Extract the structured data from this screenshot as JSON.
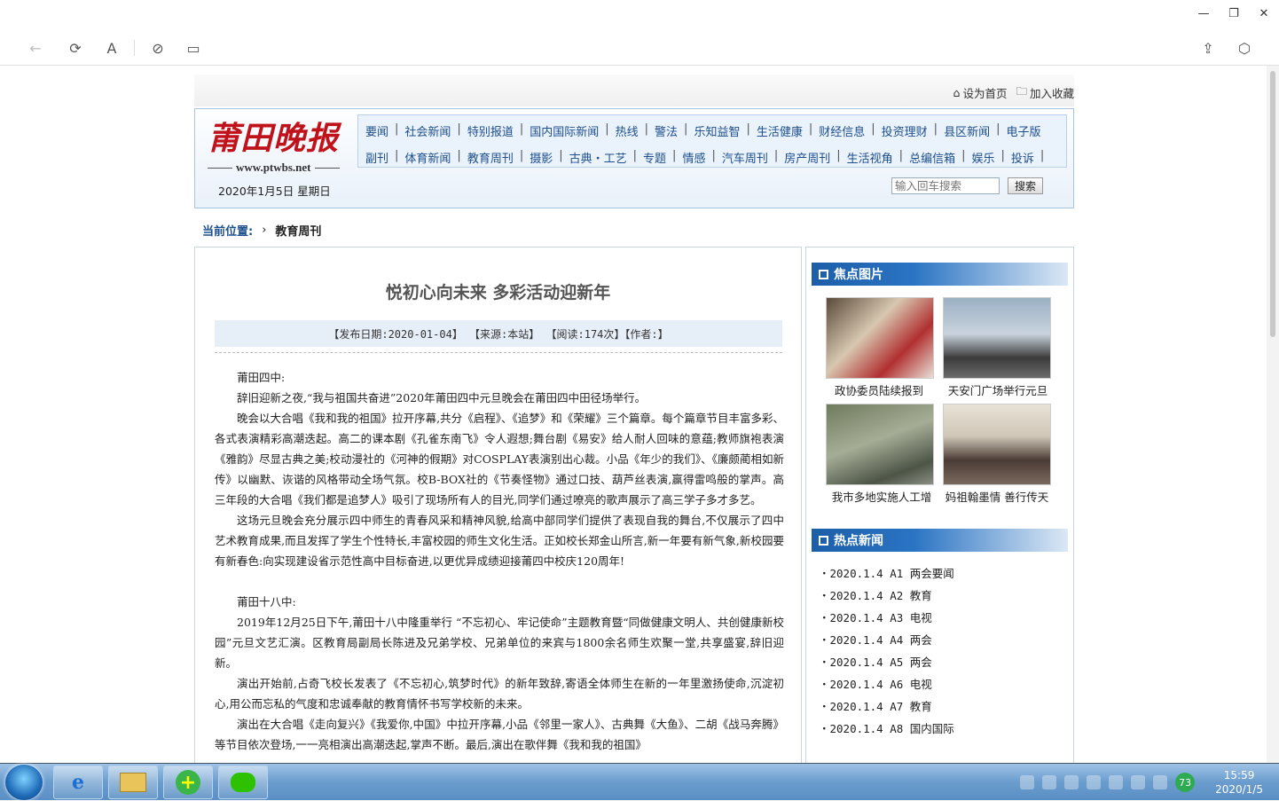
{
  "window": {
    "minimize": "—",
    "restore": "❐",
    "close": "✕"
  },
  "toolbar": {
    "back": "←",
    "refresh": "⟳",
    "font": "A",
    "link": "⊘",
    "tab": "▭",
    "share": "⇪",
    "cube": "⬡"
  },
  "toplinks": {
    "home": "设为首页",
    "fav": "加入收藏"
  },
  "logo": {
    "brand": "莆田晚报",
    "url": "www.ptwbs.net"
  },
  "date": "2020年1月5日  星期日",
  "nav": {
    "row1": [
      "要闻",
      "社会新闻",
      "特别报道",
      "国内国际新闻",
      "热线",
      "警法",
      "乐知益智",
      "生活健康",
      "财经信息",
      "投资理财",
      "县区新闻",
      "电子版"
    ],
    "row2": [
      "副刊",
      "体育新闻",
      "教育周刊",
      "摄影",
      "古典・工艺",
      "专题",
      "情感",
      "汽车周刊",
      "房产周刊",
      "生活视角",
      "总编信箱",
      "娱乐",
      "投诉"
    ]
  },
  "search": {
    "placeholder": "输入回车搜索",
    "button": "搜索"
  },
  "crumb": {
    "label": "当前位置:",
    "sep": "›",
    "current": "教育周刊"
  },
  "article": {
    "title": "悦初心向未来 多彩活动迎新年",
    "meta": "【发布日期:2020-01-04】 【来源:本站】 【阅读:174次】【作者:】",
    "paragraphs": [
      "莆田四中:",
      "辞旧迎新之夜,“我与祖国共奋进”2020年莆田四中元旦晚会在莆田四中田径场举行。",
      "晚会以大合唱《我和我的祖国》拉开序幕,共分《启程》、《追梦》和《荣耀》三个篇章。每个篇章节目丰富多彩、各式表演精彩高潮迭起。高二的课本剧《孔雀东南飞》令人遐想;舞台剧《易安》给人耐人回味的意蕴;教师旗袍表演《雅韵》尽显古典之美;校动漫社的《河神的假期》对COSPLAY表演别出心裁。小品《年少的我们》、《廉颇蔺相如新传》以幽默、诙谐的风格带动全场气氛。校B-BOX社的《节奏怪物》通过口技、葫芦丝表演,赢得雷鸣般的掌声。高三年段的大合唱《我们都是追梦人》吸引了现场所有人的目光,同学们通过嘹亮的歌声展示了高三学子多才多艺。",
      "这场元旦晚会充分展示四中师生的青春风采和精神风貌,给高中部同学们提供了表现自我的舞台,不仅展示了四中艺术教育成果,而且发挥了学生个性特长,丰富校园的师生文化生活。正如校长郑金山所言,新一年要有新气象,新校园要有新春色:向实现建设省示范性高中目标奋进,以更优异成绩迎接莆四中校庆120周年!",
      "",
      "莆田十八中:",
      "2019年12月25日下午,莆田十八中隆重举行 “不忘初心、牢记使命”主题教育暨“同做健康文明人、共创健康新校园”元旦文艺汇演。区教育局副局长陈进及兄弟学校、兄弟单位的来宾与1800余名师生欢聚一堂,共享盛宴,辞旧迎新。",
      "演出开始前,占奇飞校长发表了《不忘初心,筑梦时代》的新年致辞,寄语全体师生在新的一年里激扬使命,沉淀初心,用公而忘私的气度和忠诚奉献的教育情怀书写学校新的未来。",
      "演出在大合唱《走向复兴》《我爱你,中国》中拉开序幕,小品《邻里一家人》、古典舞《大鱼》、二胡《战马奔腾》等节目依次登场,一一亮相演出高潮迭起,掌声不断。最后,演出在歌伴舞《我和我的祖国》"
    ]
  },
  "side": {
    "focus_title": "焦点图片",
    "photos": [
      {
        "caption": "政协委员陆续报到"
      },
      {
        "caption": "天安门广场举行元旦"
      },
      {
        "caption": "我市多地实施人工增"
      },
      {
        "caption": "妈祖翰墨情 善行传天"
      }
    ],
    "hot_title": "热点新闻",
    "hot": [
      "・2020.1.4 A1 两会要闻",
      "・2020.1.4 A2 教育",
      "・2020.1.4 A3 电视",
      "・2020.1.4 A4 两会",
      "・2020.1.4 A5 两会",
      "・2020.1.4 A6 电视",
      "・2020.1.4 A7 教育",
      "・2020.1.4 A8 国内国际"
    ]
  },
  "taskbar": {
    "badge": "73",
    "time": "15:59",
    "date": "2020/1/5"
  }
}
